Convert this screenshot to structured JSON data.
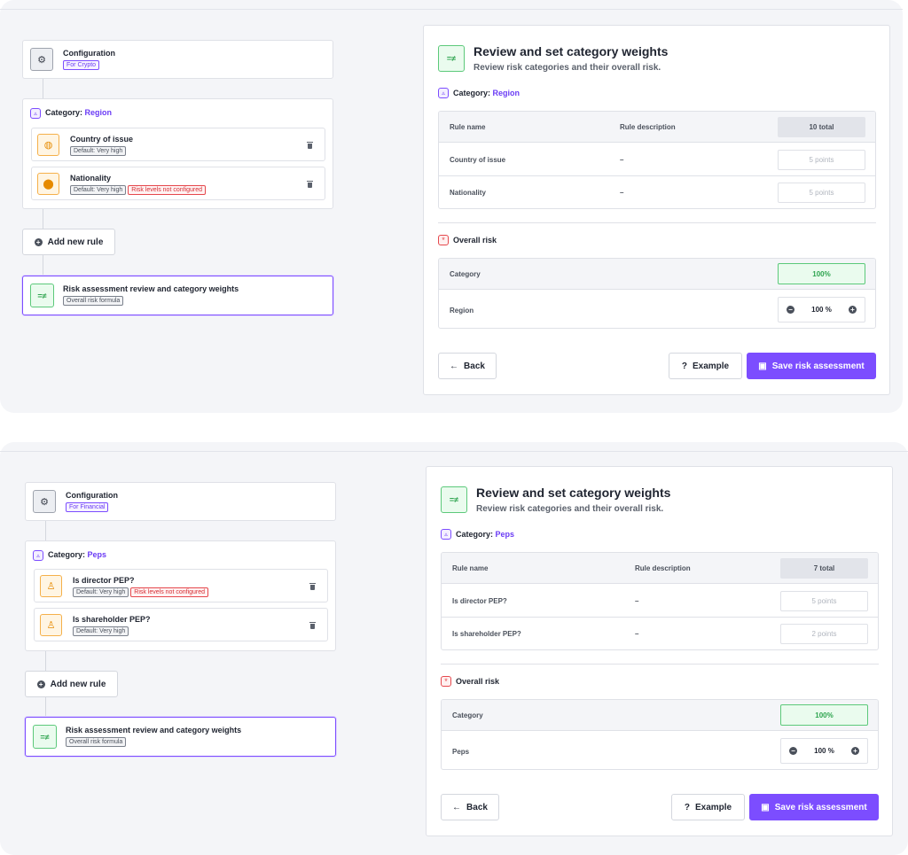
{
  "screens": [
    {
      "left": {
        "config": {
          "title": "Configuration",
          "badge": "For Crypto",
          "icon": "gear-icon"
        },
        "category": {
          "prefix": "Category:",
          "name": "Region",
          "rules": [
            {
              "title": "Country of issue",
              "icon": "globe-icon",
              "badges": [
                {
                  "text": "Default: Very high",
                  "kind": "grey"
                }
              ]
            },
            {
              "title": "Nationality",
              "icon": "location-pin-icon",
              "badges": [
                {
                  "text": "Default: Very high",
                  "kind": "grey"
                },
                {
                  "text": "Risk levels not configured",
                  "kind": "red"
                }
              ]
            }
          ]
        },
        "add_rule": "Add new rule",
        "review": {
          "title": "Risk assessment review and category weights",
          "badge": "Overall risk formula"
        }
      },
      "right": {
        "title": "Review and set category weights",
        "subtitle": "Review risk categories and their overall risk.",
        "category_prefix": "Category:",
        "category_name": "Region",
        "table_headers": {
          "rule_name": "Rule name",
          "rule_description": "Rule description",
          "total": "10 total"
        },
        "rows": [
          {
            "name": "Country of issue",
            "description": "–",
            "points": "5 points"
          },
          {
            "name": "Nationality",
            "description": "–",
            "points": "5 points"
          }
        ],
        "overall_label": "Overall risk",
        "overall_header": {
          "category": "Category",
          "percent": "100%"
        },
        "overall_row": {
          "name": "Region",
          "value": "100 %"
        },
        "back": "Back",
        "example": "Example",
        "save": "Save risk assessment"
      }
    },
    {
      "left": {
        "config": {
          "title": "Configuration",
          "badge": "For Financial",
          "icon": "gear-icon"
        },
        "category": {
          "prefix": "Category:",
          "name": "Peps",
          "rules": [
            {
              "title": "Is director PEP?",
              "icon": "person-icon",
              "badges": [
                {
                  "text": "Default: Very high",
                  "kind": "grey"
                },
                {
                  "text": "Risk levels not configured",
                  "kind": "red"
                }
              ]
            },
            {
              "title": "Is shareholder PEP?",
              "icon": "person-icon",
              "badges": [
                {
                  "text": "Default: Very high",
                  "kind": "grey"
                }
              ]
            }
          ]
        },
        "add_rule": "Add new rule",
        "review": {
          "title": "Risk assessment review and category weights",
          "badge": "Overall risk formula"
        }
      },
      "right": {
        "title": "Review and set category weights",
        "subtitle": "Review risk categories and their overall risk.",
        "category_prefix": "Category:",
        "category_name": "Peps",
        "table_headers": {
          "rule_name": "Rule name",
          "rule_description": "Rule description",
          "total": "7 total"
        },
        "rows": [
          {
            "name": "Is director PEP?",
            "description": "–",
            "points": "5 points"
          },
          {
            "name": "Is shareholder PEP?",
            "description": "–",
            "points": "2 points"
          }
        ],
        "overall_label": "Overall risk",
        "overall_header": {
          "category": "Category",
          "percent": "100%"
        },
        "overall_row": {
          "name": "Peps",
          "value": "100 %"
        },
        "back": "Back",
        "example": "Example",
        "save": "Save risk assessment"
      }
    }
  ]
}
